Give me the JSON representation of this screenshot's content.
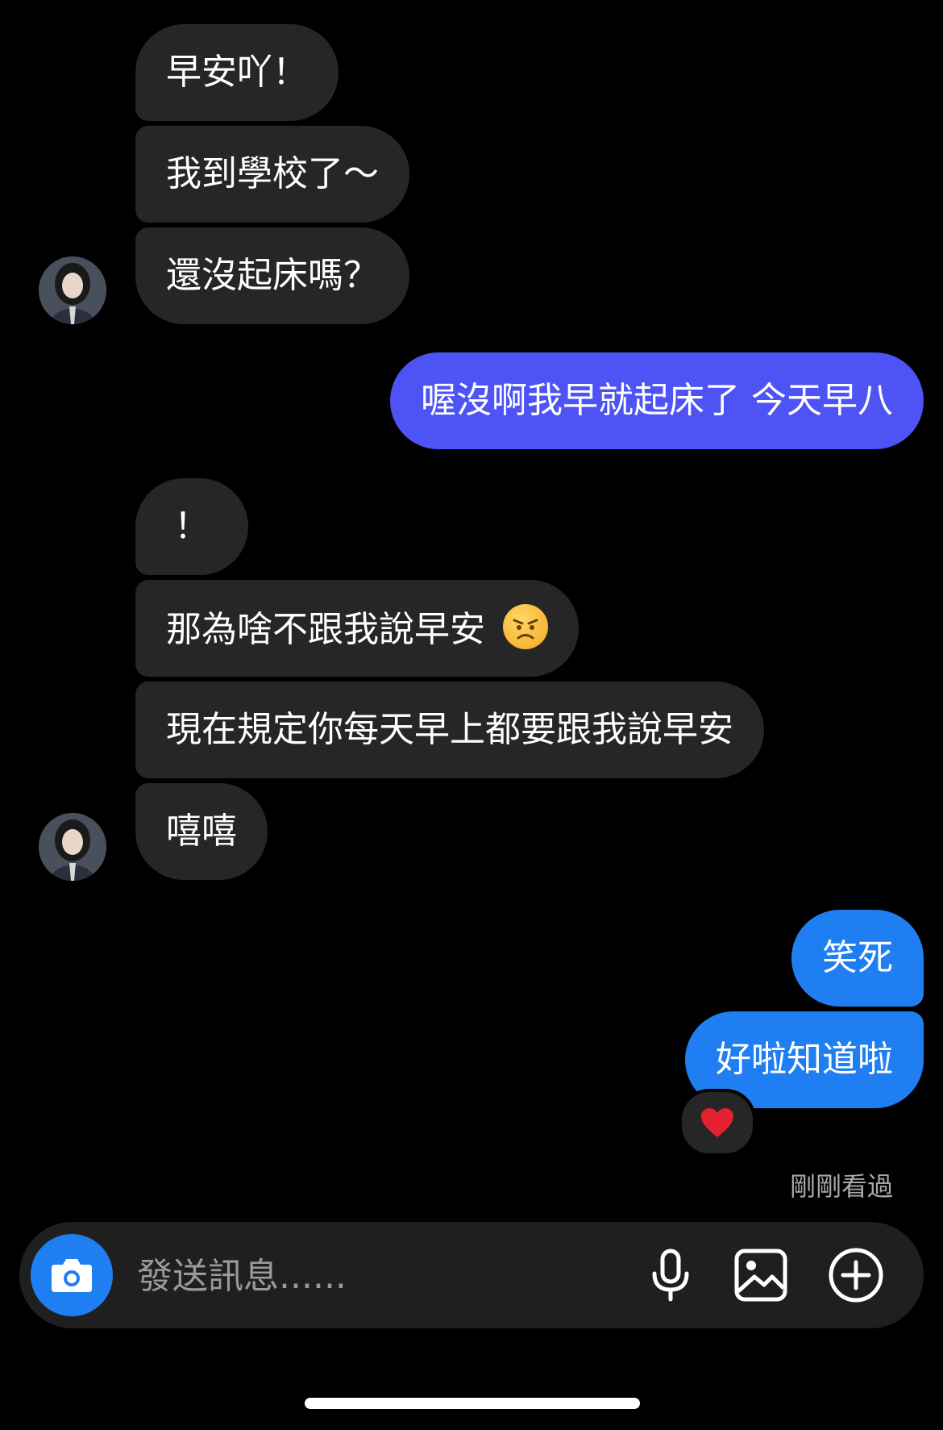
{
  "messages": [
    {
      "text": "早安吖！",
      "direction": "incoming"
    },
    {
      "text": "我到學校了～",
      "direction": "incoming"
    },
    {
      "text": "還沒起床嗎？",
      "direction": "incoming"
    },
    {
      "text": "喔沒啊我早就起床了 今天早八",
      "direction": "outgoing"
    },
    {
      "text": "！",
      "direction": "incoming"
    },
    {
      "text": "那為啥不跟我說早安",
      "direction": "incoming",
      "emoji": "angry-face"
    },
    {
      "text": "現在規定你每天早上都要跟我說早安",
      "direction": "incoming"
    },
    {
      "text": "嘻嘻",
      "direction": "incoming"
    },
    {
      "text": "笑死",
      "direction": "outgoing"
    },
    {
      "text": "好啦知道啦",
      "direction": "outgoing",
      "reaction": "heart"
    }
  ],
  "status": {
    "seen": "剛剛看過"
  },
  "composer": {
    "placeholder": "發送訊息......"
  },
  "icons": [
    "camera-icon",
    "microphone-icon",
    "image-icon",
    "add-circle-icon",
    "angry-face-emoji",
    "heart-icon"
  ],
  "colors": {
    "outgoing_purple": "#4d53f5",
    "outgoing_blue": "#1f7ff2",
    "incoming": "#262626",
    "background": "#000000"
  }
}
